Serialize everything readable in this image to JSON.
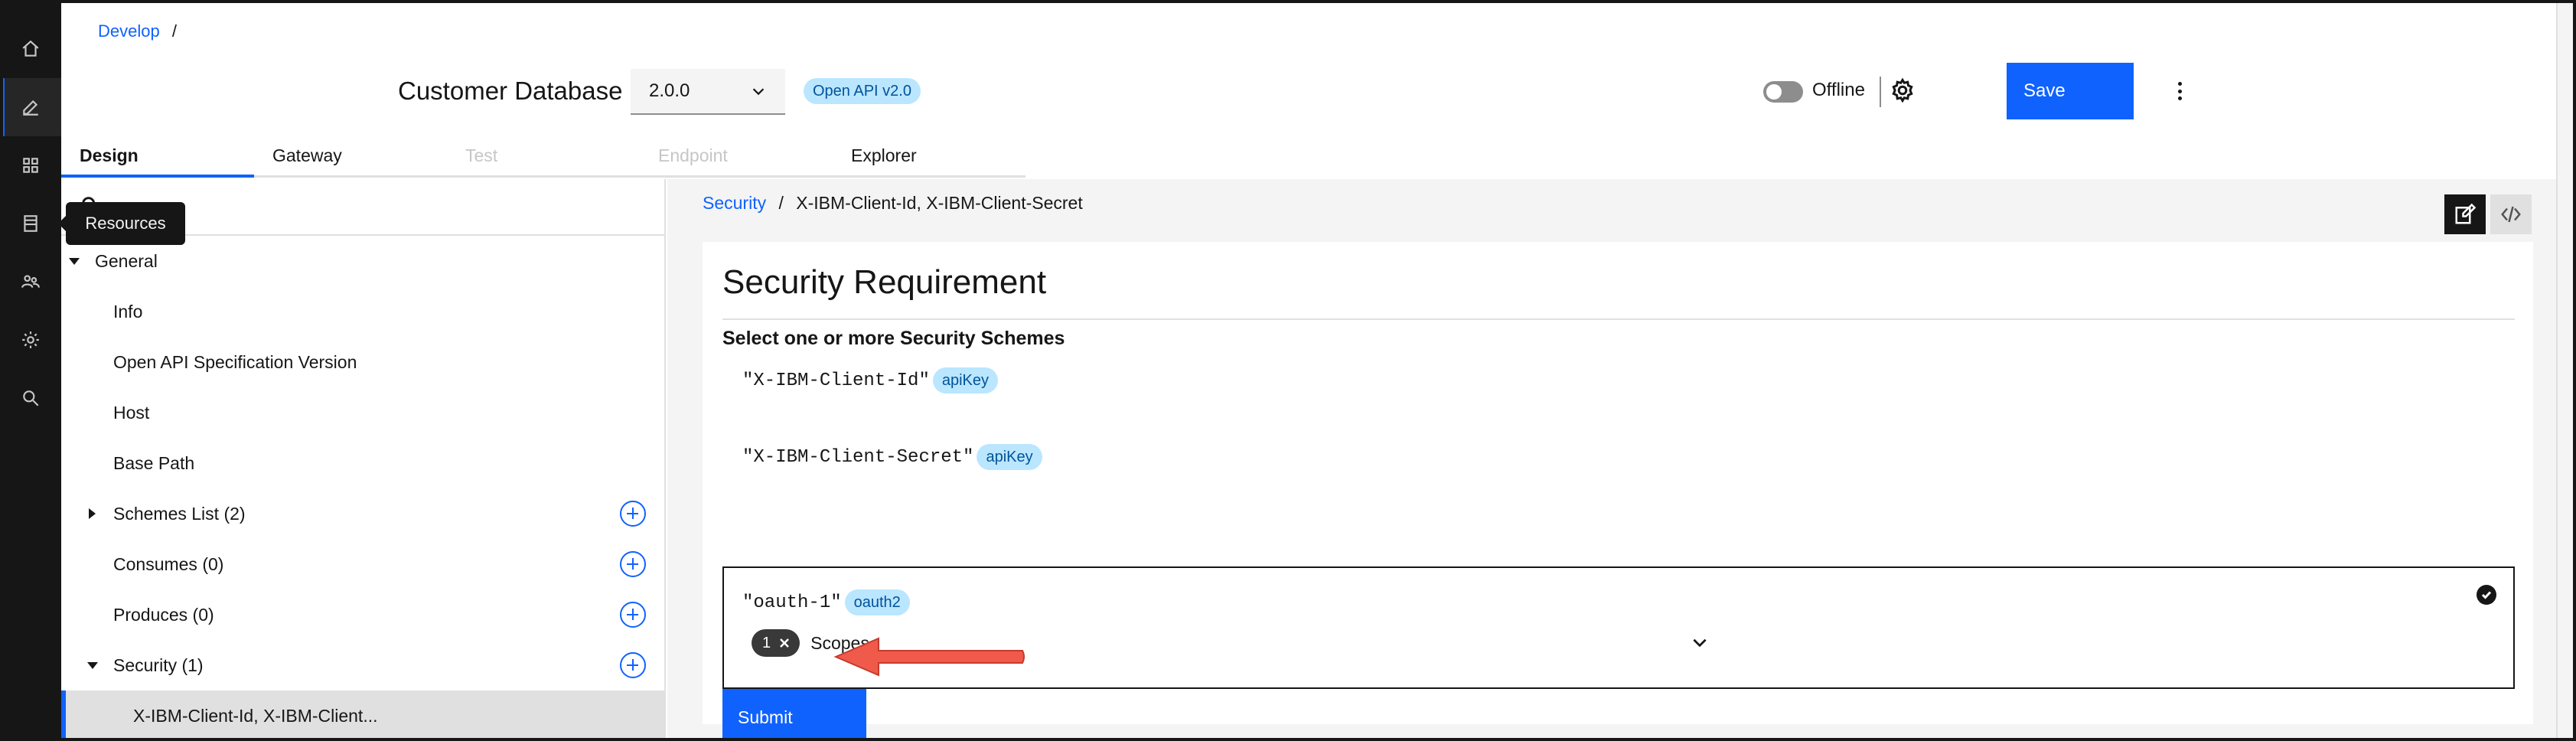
{
  "breadcrumb": {
    "root": "Develop",
    "separator": "/"
  },
  "header": {
    "title": "Customer Database",
    "version": "2.0.0",
    "spec_tag": "Open API v2.0",
    "offline_label": "Offline",
    "save_label": "Save"
  },
  "rail": {
    "items": [
      "home-icon",
      "edit-icon",
      "apps-icon",
      "resources-icon",
      "users-icon",
      "settings-icon",
      "search-icon"
    ],
    "tooltip": "Resources"
  },
  "tabs": [
    {
      "label": "Design",
      "state": "active"
    },
    {
      "label": "Gateway",
      "state": "normal"
    },
    {
      "label": "Test",
      "state": "disabled"
    },
    {
      "label": "Endpoint",
      "state": "disabled"
    },
    {
      "label": "Explorer",
      "state": "normal"
    }
  ],
  "sidenav": {
    "items": [
      {
        "label": "General"
      },
      {
        "label": "Info"
      },
      {
        "label": "Open API Specification Version"
      },
      {
        "label": "Host"
      },
      {
        "label": "Base Path"
      },
      {
        "label": "Schemes List (2)"
      },
      {
        "label": "Consumes (0)"
      },
      {
        "label": "Produces (0)"
      },
      {
        "label": "Security (1)"
      },
      {
        "label": "X-IBM-Client-Id, X-IBM-Client..."
      }
    ]
  },
  "main": {
    "breadcrumb_link": "Security",
    "breadcrumb_sep": "/",
    "breadcrumb_current": "X-IBM-Client-Id, X-IBM-Client-Secret",
    "card_title": "Security Requirement",
    "card_subtitle": "Select one or more Security Schemes",
    "schemes": [
      {
        "name": "\"X-IBM-Client-Id\"",
        "type": "apiKey"
      },
      {
        "name": "\"X-IBM-Client-Secret\"",
        "type": "apiKey"
      },
      {
        "name": "\"oauth-1\"",
        "type": "oauth2",
        "selected": true
      }
    ],
    "scopes": {
      "count": "1",
      "label": "Scopes"
    },
    "submit_label": "Submit"
  },
  "colors": {
    "accent": "#0f62fe",
    "rail_bg": "#161616",
    "tag_bg": "#bae6ff",
    "annotation_arrow": "#f05a4a"
  }
}
